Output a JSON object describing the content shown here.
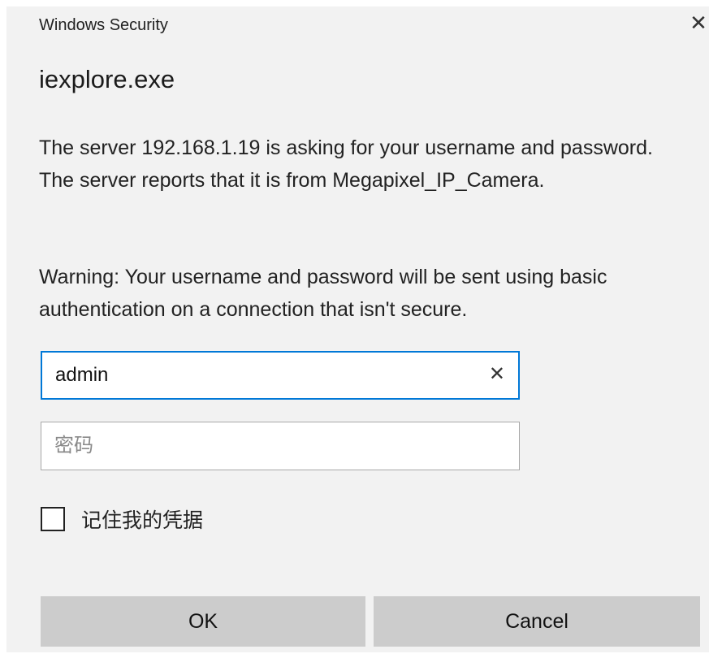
{
  "window": {
    "title": "Windows Security",
    "close_glyph": "✕",
    "app_name": "iexplore.exe"
  },
  "message": "The server 192.168.1.19 is asking for your username and password. The server reports that it is from Megapixel_IP_Camera.",
  "warning": "Warning: Your username and password will be sent using basic authentication on a connection that isn't secure.",
  "username": {
    "value": "admin",
    "clear_glyph": "✕"
  },
  "password": {
    "value": "",
    "placeholder": "密码"
  },
  "remember": {
    "label": "记住我的凭据",
    "checked": false
  },
  "buttons": {
    "ok": "OK",
    "cancel": "Cancel"
  },
  "colors": {
    "dialog_background": "#f2f2f2",
    "focus_border": "#0078d7",
    "button_background": "#cccccc"
  }
}
